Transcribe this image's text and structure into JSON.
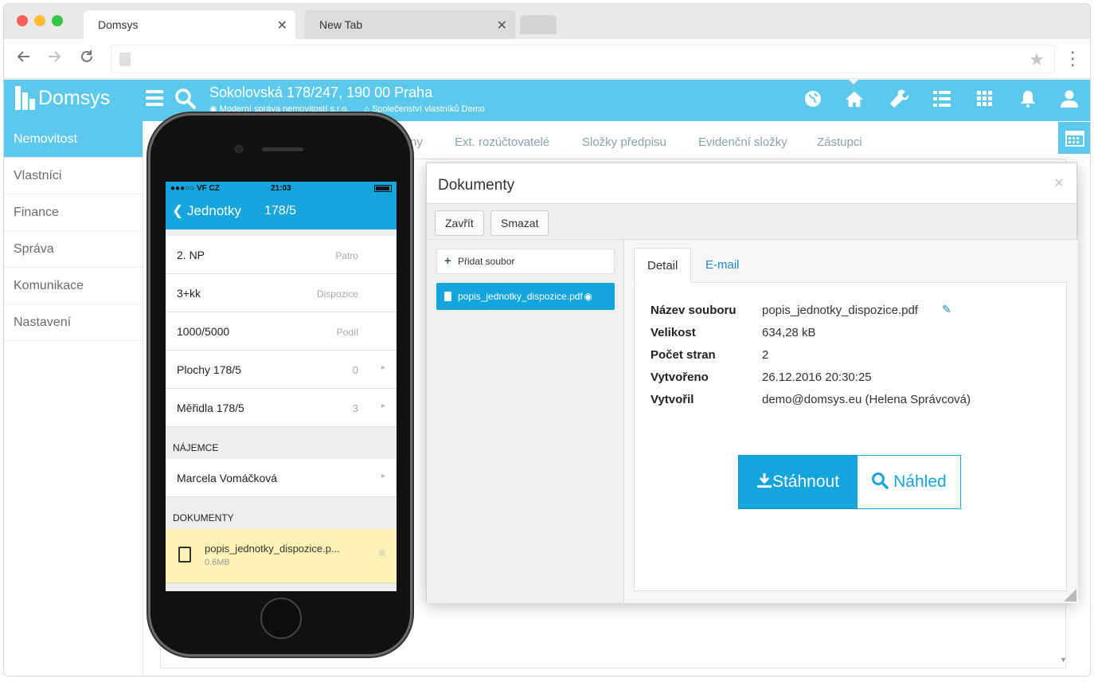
{
  "browser": {
    "tabs": [
      {
        "label": "Domsys",
        "active": true
      },
      {
        "label": "New Tab",
        "active": false
      }
    ],
    "close_glyph": "✕"
  },
  "app": {
    "logo_text": "Domsys",
    "address_main": "Sokolovská 178/247, 190 00 Praha",
    "address_company": "Moderní správa nemovitostí s.r.o.",
    "address_association": "Společenství vlastníků Demo",
    "accent_color": "#5cc9ec",
    "header_icons": [
      "globe-icon",
      "home-icon",
      "wrench-icon",
      "list-icon",
      "grid-icon",
      "bell-icon",
      "user-icon"
    ]
  },
  "sidebar": {
    "items": [
      {
        "label": "Nemovitost",
        "active": true
      },
      {
        "label": "Vlastníci"
      },
      {
        "label": "Finance"
      },
      {
        "label": "Správa"
      },
      {
        "label": "Komunikace"
      },
      {
        "label": "Nastavení"
      }
    ]
  },
  "subnav": {
    "partial": "ny",
    "tabs": [
      "Ext. rozúčtovatelé",
      "Složky předpisu",
      "Evidenční složky",
      "Zástupci"
    ]
  },
  "modal": {
    "title": "Dokumenty",
    "close_glyph": "×",
    "buttons": {
      "close": "Zavřít",
      "delete": "Smazat"
    },
    "add_file": "Přidat soubor",
    "files": [
      {
        "name": "popis_jednotky_dispozice.pdf"
      }
    ],
    "tabs": {
      "detail": "Detail",
      "email": "E-mail"
    },
    "props": [
      {
        "label": "Název souboru",
        "value": "popis_jednotky_dispozice.pdf"
      },
      {
        "label": "Velikost",
        "value": "634,28 kB"
      },
      {
        "label": "Počet stran",
        "value": "2"
      },
      {
        "label": "Vytvořeno",
        "value": "26.12.2016 20:30:25"
      },
      {
        "label": "Vytvořil",
        "value": "demo@domsys.eu (Helena Správcová)"
      }
    ],
    "download_label": "Stáhnout",
    "preview_label": "Náhled"
  },
  "phone": {
    "status": {
      "carrier": "●●●○○ VF CZ",
      "time": "21:03"
    },
    "nav": {
      "back": "Jednotky",
      "title": "178/5"
    },
    "rows": [
      {
        "label": "2. NP",
        "hint": "Patro"
      },
      {
        "label": "3+kk",
        "hint": "Dispozice"
      },
      {
        "label": "1000/5000",
        "hint": "Podíl"
      },
      {
        "label": "Plochy 178/5",
        "count": "0"
      },
      {
        "label": "Měřidla 178/5",
        "count": "3"
      }
    ],
    "tenant_section": "NÁJEMCE",
    "tenant": "Marcela Vomáčková",
    "documents_section": "DOKUMENTY",
    "document": {
      "name": "popis_jednotky_dispozice.p...",
      "size": "0.6MB"
    }
  }
}
